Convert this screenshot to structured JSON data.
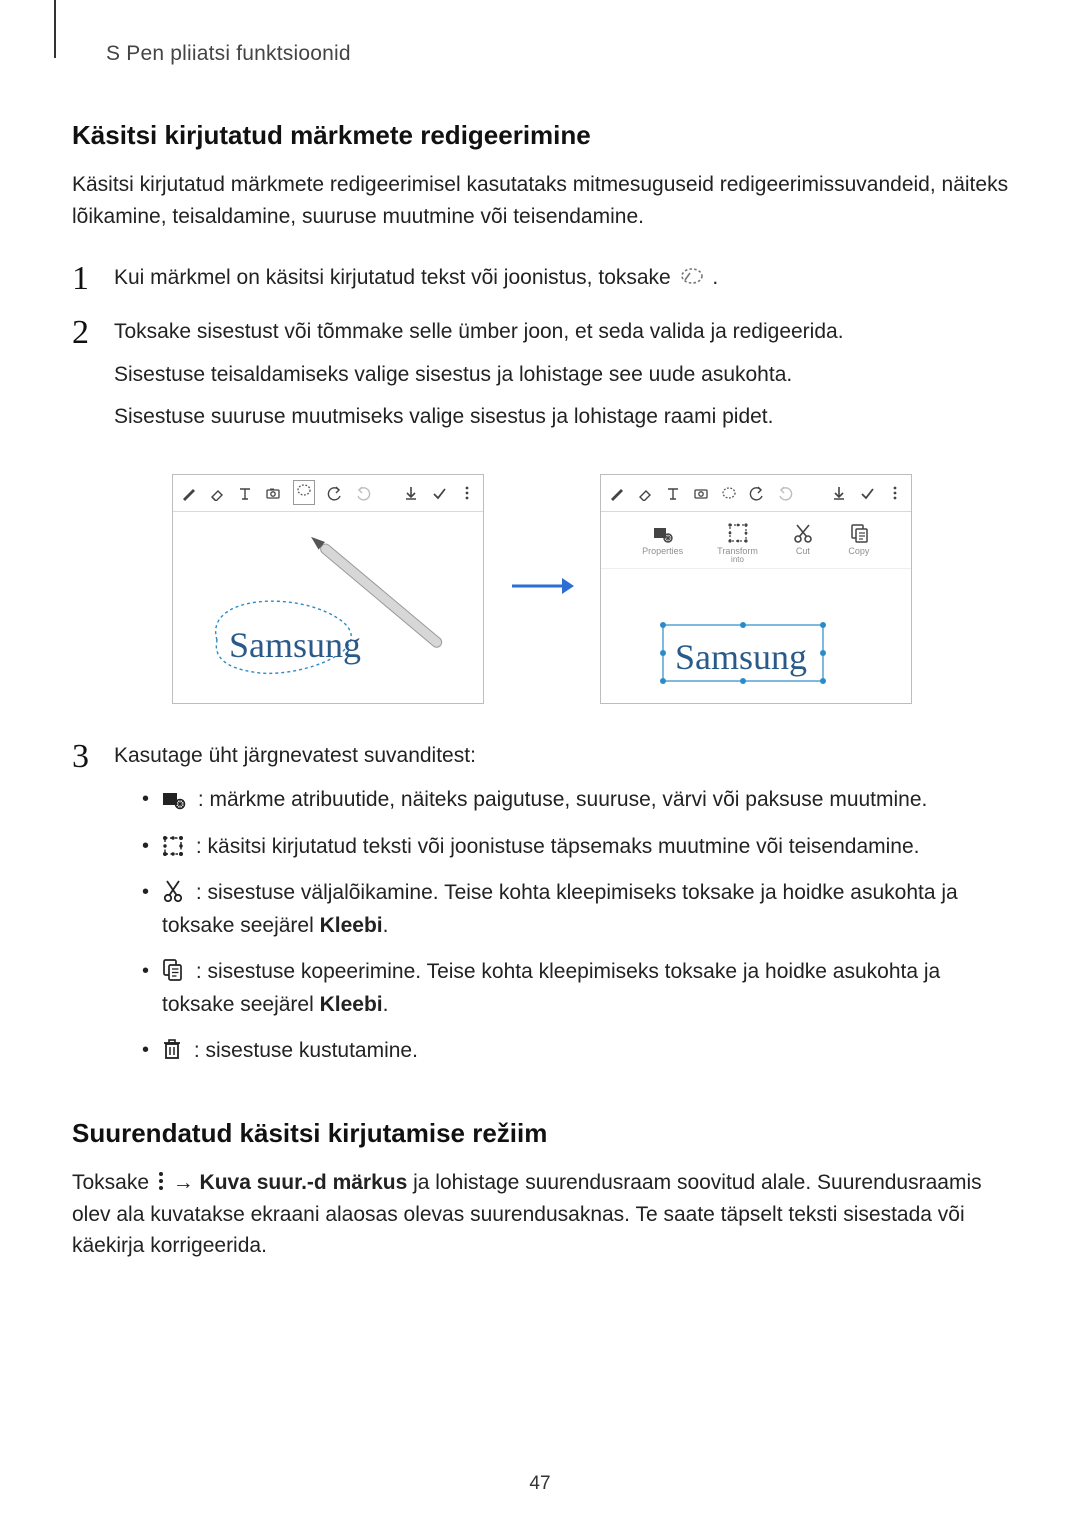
{
  "header": "S Pen pliiatsi funktsioonid",
  "section1": {
    "title": "Käsitsi kirjutatud märkmete redigeerimine",
    "lead": "Käsitsi kirjutatud märkmete redigeerimisel kasutataks mitmesuguseid redigeerimissuvandeid, näiteks lõikamine, teisaldamine, suuruse muutmine või teisendamine."
  },
  "step1": {
    "text_before": "Kui märkmel on käsitsi kirjutatud tekst või joonistus, toksake ",
    "icon_name": "selection-icon",
    "text_after": "."
  },
  "step2": {
    "line1": "Toksake sisestust või tõmmake selle ümber joon, et seda valida ja redigeerida.",
    "line2": "Sisestuse teisaldamiseks valige sisestus ja lohistage see uude asukohta.",
    "line3": "Sisestuse suuruse muutmiseks valige sisestus ja lohistage raami pidet."
  },
  "step3": {
    "intro": "Kasutage üht järgnevatest suvanditest:",
    "items": [
      {
        "icon": "properties-icon",
        "text": ": märkme atribuutide, näiteks paigutuse, suuruse, värvi või paksuse muutmine."
      },
      {
        "icon": "transform-icon",
        "text": ": käsitsi kirjutatud teksti või joonistuse täpsemaks muutmine või teisendamine."
      },
      {
        "icon": "cut-icon",
        "text_before": ": sisestuse väljalõikamine. Teise kohta kleepimiseks toksake ja hoidke asukohta ja toksake seejärel ",
        "bold": "Kleebi",
        "text_after": "."
      },
      {
        "icon": "copy-icon",
        "text_before": ": sisestuse kopeerimine. Teise kohta kleepimiseks toksake ja hoidke asukohta ja toksake seejärel ",
        "bold": "Kleebi",
        "text_after": "."
      },
      {
        "icon": "delete-icon",
        "text": ": sisestuse kustutamine."
      }
    ]
  },
  "figure": {
    "handwriting": "Samsung",
    "opt_labels": {
      "properties": "Properties",
      "transform": "Transform",
      "transform_sub": "into",
      "cut": "Cut",
      "copy": "Copy"
    }
  },
  "section2": {
    "title": "Suurendatud käsitsi kirjutamise režiim",
    "p_before_icon": "Toksake ",
    "icon_name": "more-icon",
    "p_after_icon": " → ",
    "bold": "Kuva suur.-d märkus",
    "p_rest": " ja lohistage suurendusraam soovitud alale. Suurendusraamis olev ala kuvatakse ekraani alaosas olevas suurendusaknas. Te saate täpselt teksti sisestada või käekirja korrigeerida."
  },
  "page_number": "47"
}
